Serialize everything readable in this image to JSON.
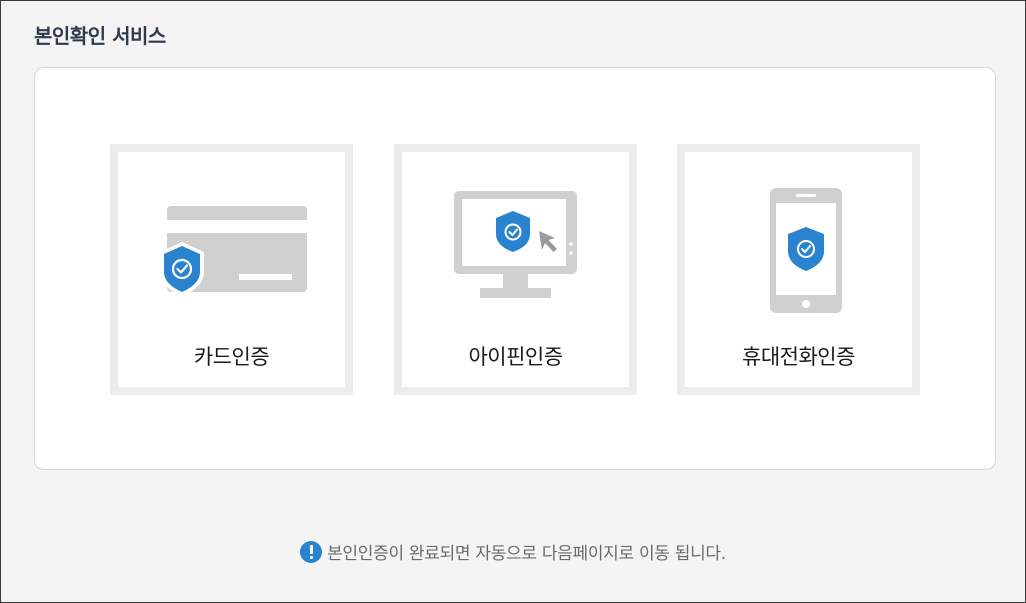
{
  "page": {
    "title": "본인확인 서비스"
  },
  "services": [
    {
      "label": "카드인증",
      "icon": "card-shield-icon"
    },
    {
      "label": "아이핀인증",
      "icon": "monitor-shield-icon"
    },
    {
      "label": "휴대전화인증",
      "icon": "phone-shield-icon"
    }
  ],
  "notice": {
    "icon": "exclamation-icon",
    "text": "본인인증이 완료되면 자동으로 다음페이지로 이동 됩니다."
  },
  "colors": {
    "accent": "#2a83cf",
    "icon_gray": "#d0d0d0",
    "card_border": "#ececec",
    "background": "#f4f4f4"
  }
}
